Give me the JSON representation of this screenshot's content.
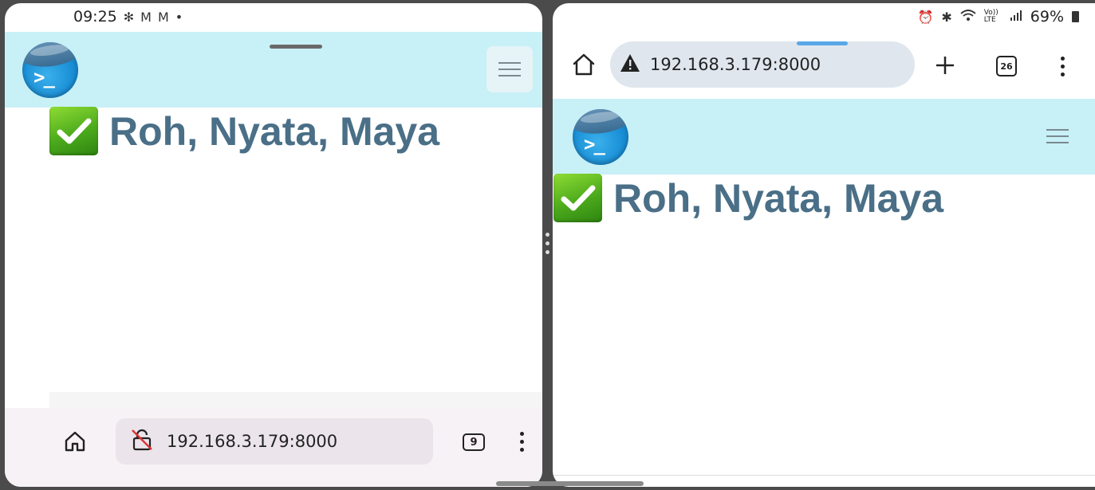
{
  "status_left": {
    "time": "09:25",
    "icons": [
      "fan-icon",
      "gmail-icon",
      "gmail-icon",
      "dot-icon"
    ]
  },
  "status_right": {
    "lte_label": "Vo)) LTE",
    "battery": "69%",
    "icons": [
      "alarm-icon",
      "bluetooth-icon",
      "wifi-icon",
      "volte-icon",
      "signal-icon",
      "battery-icon"
    ]
  },
  "left_window": {
    "site_title": "Roh, Nyata, Maya",
    "url": "192.168.3.179:8000",
    "tab_count": "9",
    "icons": [
      "home-icon",
      "insecure-lock-icon",
      "more-icon"
    ]
  },
  "right_window": {
    "site_title": "Roh, Nyata, Maya",
    "url": "192.168.3.179:8000",
    "tab_count": "26",
    "icons": [
      "home-icon",
      "warning-icon",
      "plus-icon",
      "more-icon"
    ]
  },
  "colors": {
    "header_bg": "#c8f0f7",
    "title_color": "#4a6f87",
    "divider": "#4b4b4b",
    "accent_blue": "#5aa8e8"
  }
}
